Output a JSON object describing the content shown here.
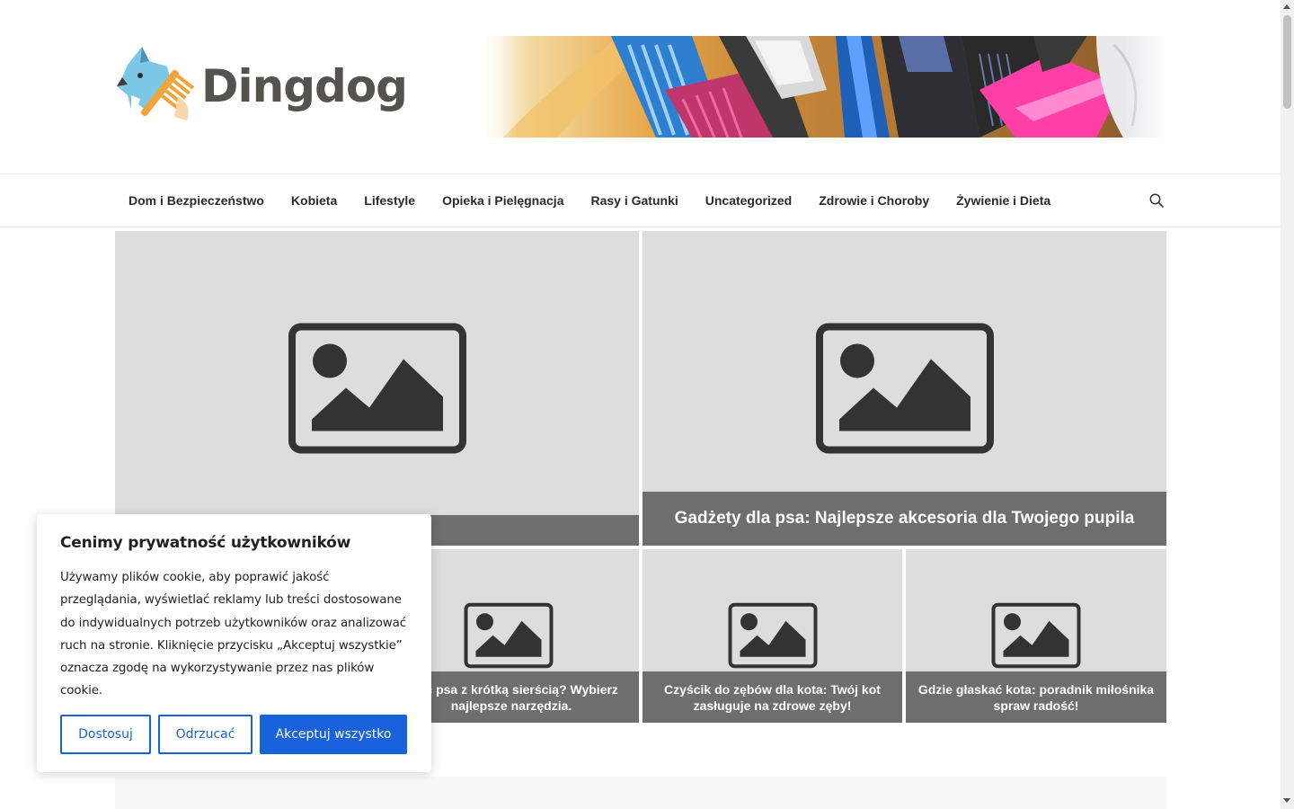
{
  "header": {
    "logo_text": "Dingdog"
  },
  "nav": {
    "items": [
      "Dom i Bezpieczeństwo",
      "Kobieta",
      "Lifestyle",
      "Opieka i Pielęgnacja",
      "Rasy i Gatunki",
      "Uncategorized",
      "Zdrowie i Choroby",
      "Żywienie i Dieta"
    ],
    "search_icon": "search-icon"
  },
  "featured": {
    "big": [
      {
        "title": ""
      },
      {
        "title": "Gadżety dla psa: Najlepsze akcesoria dla Twojego pupila"
      }
    ],
    "small": [
      {
        "title": ""
      },
      {
        "title": "esać psa z krótką sierścią? Wybierz najlepsze narzędzia."
      },
      {
        "title": "Czyścik do zębów dla kota: Twój kot zasługuje na zdrowe zęby!"
      },
      {
        "title": "Gdzie głaskać kota: poradnik miłośnika spraw radość!"
      }
    ]
  },
  "cookie": {
    "title": "Cenimy prywatność użytkowników",
    "text": "Używamy plików cookie, aby poprawić jakość przeglądania, wyświetlać reklamy lub treści dostosowane do indywidualnych potrzeb użytkowników oraz analizować ruch na stronie. Kliknięcie przycisku „Akceptuj wszystkie” oznacza zgodę na wykorzystywanie przez nas plików cookie.",
    "customize": "Dostosuj",
    "reject": "Odrzucać",
    "accept": "Akceptuj wszystko"
  },
  "colors": {
    "accent": "#1863dc",
    "logo_text": "#555350",
    "tile_bg": "#dddddd",
    "caption_bg": "#5f5f5f"
  }
}
